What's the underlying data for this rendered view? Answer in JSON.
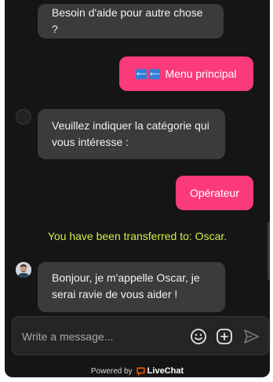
{
  "messages": {
    "help_other": "Besoin d'aide pour autre chose ?",
    "menu_button_flags": "🔙",
    "menu_button_label": "Menu principal",
    "category_prompt_line1": "Veuillez indiquer la catégorie qui",
    "category_prompt_line2": "vous intéresse :",
    "operator_button": "Opérateur",
    "system_transfer": "You have been transferred to: Oscar.",
    "oscar_greeting_line1": "Bonjour, je m'appelle Oscar, je",
    "oscar_greeting_line2": "serai ravie de vous aider !"
  },
  "composer": {
    "placeholder": "Write a message...",
    "value": ""
  },
  "footer": {
    "powered_by": "Powered by",
    "brand": "LiveChat"
  },
  "colors": {
    "background": "#151515",
    "incoming_bubble": "#3b3b3b",
    "outgoing_button": "#fb3b79",
    "system_text": "#d5e94a",
    "brand_orange": "#ff5100"
  },
  "icons": [
    "emoji-icon",
    "attachment-plus-icon",
    "send-icon",
    "livechat-logo-icon",
    "back-arrow-icon"
  ]
}
